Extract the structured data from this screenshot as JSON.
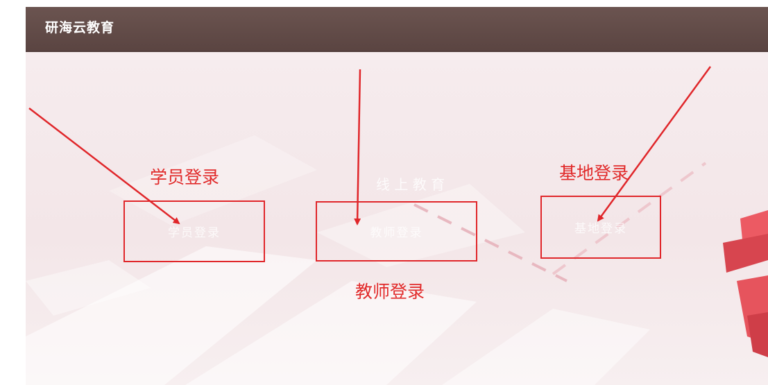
{
  "header": {
    "brand": "研海云教育"
  },
  "colors": {
    "header_bg": "#5e4845",
    "annotation_red": "#e0262a",
    "stage_bg": "#f4e8ea"
  },
  "logins": [
    {
      "id": "student",
      "annotation": "学员登录"
    },
    {
      "id": "teacher",
      "annotation": "教师登录"
    },
    {
      "id": "base",
      "annotation": "基地登录"
    }
  ]
}
